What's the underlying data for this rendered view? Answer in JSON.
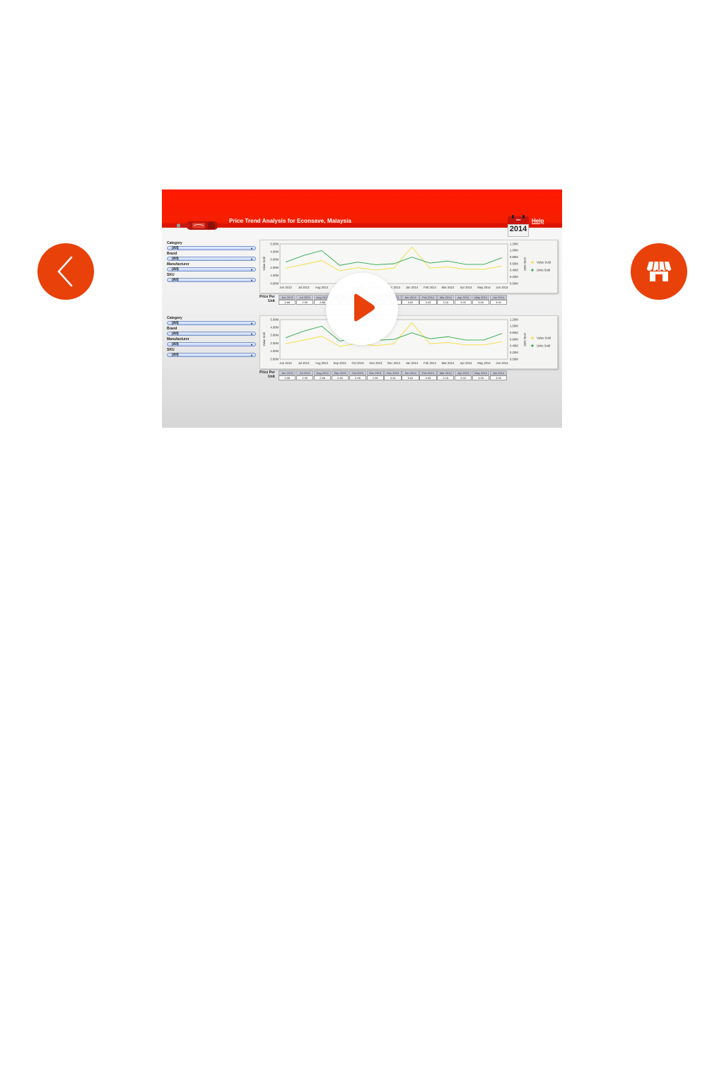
{
  "nav": {
    "back_icon": "chevron-left-icon",
    "store_icon": "storefront-icon",
    "accent": "#e8410a"
  },
  "dashboard": {
    "title": "Price Trend Analysis for Econsave, Malaysia",
    "help_label": "Help",
    "calendar": {
      "month": "Jun",
      "year": "2014"
    },
    "brand_color": "#ff1a00"
  },
  "panels": [
    {
      "filters": [
        {
          "label": "Category",
          "value": "(All)"
        },
        {
          "label": "Brand",
          "value": "(All)"
        },
        {
          "label": "Manufacturer",
          "value": "(All)"
        },
        {
          "label": "SKU",
          "value": "(All)"
        }
      ],
      "price_label_1": "Price Per",
      "price_label_2": "Unit",
      "price_values": [
        "3.68",
        "2.90",
        "2.88",
        "2.83",
        "2.98",
        "2.96",
        "3.34",
        "5.62",
        "3.03",
        "3.15",
        "3.02",
        "3.05",
        "3.00"
      ]
    },
    {
      "filters": [
        {
          "label": "Category",
          "value": "(All)"
        },
        {
          "label": "Brand",
          "value": "(All)"
        },
        {
          "label": "Manufacturer",
          "value": "(All)"
        },
        {
          "label": "SKU",
          "value": "(All)"
        }
      ],
      "price_label_1": "Price Per",
      "price_label_2": "Unit",
      "price_values": [
        "3.68",
        "2.90",
        "2.88",
        "2.83",
        "2.98",
        "2.96",
        "3.34",
        "5.62",
        "3.03",
        "3.15",
        "3.02",
        "3.05",
        "3.00"
      ]
    }
  ],
  "chart_data": [
    {
      "type": "line",
      "categories": [
        "Jun 2013",
        "Jul 2013",
        "Aug 2013",
        "Sep 2013",
        "Oct 2013",
        "Nov 2013",
        "Dec 2013",
        "Jan 2014",
        "Feb 2014",
        "Mar 2014",
        "Apr 2014",
        "May 2014",
        "Jun 2014"
      ],
      "ylabel": "Value Sold",
      "y2label": "Units Sold",
      "ylim": [
        0,
        5000000
      ],
      "y2lim": [
        0,
        1200000
      ],
      "yticks": [
        "0.00M",
        "1.00M",
        "2.00M",
        "3.00M",
        "4.00M",
        "5.00M"
      ],
      "y2ticks": [
        "0.00M",
        "0.20M",
        "0.40M",
        "0.60M",
        "0.80M",
        "1.00M",
        "1.20M"
      ],
      "legend_position": "right",
      "grid": false,
      "series": [
        {
          "name": "Value Sold",
          "color": "#f2dd3a",
          "axis": "left",
          "values": [
            1950000,
            2400000,
            2900000,
            1600000,
            2000000,
            1700000,
            1950000,
            4600000,
            1950000,
            2100000,
            1800000,
            1800000,
            2200000
          ]
        },
        {
          "name": "Units Sold",
          "color": "#2aa84a",
          "axis": "right",
          "values": [
            650000,
            850000,
            1000000,
            550000,
            650000,
            570000,
            600000,
            800000,
            620000,
            680000,
            580000,
            580000,
            780000
          ]
        }
      ]
    },
    {
      "type": "line",
      "categories": [
        "Jun 2013",
        "Jul 2013",
        "Aug 2013",
        "Sep 2013",
        "Oct 2013",
        "Nov 2013",
        "Dec 2013",
        "Jan 2014",
        "Feb 2014",
        "Mar 2014",
        "Apr 2014",
        "May 2014",
        "Jun 2014"
      ],
      "ylabel": "Value Sold",
      "y2label": "Units Sold",
      "ylim": [
        0,
        5000000
      ],
      "y2lim": [
        0,
        1200000
      ],
      "yticks": [
        "0.00M",
        "1.00M",
        "2.00M",
        "3.00M",
        "4.00M",
        "5.00M"
      ],
      "y2ticks": [
        "0.00M",
        "0.20M",
        "0.40M",
        "0.60M",
        "0.80M",
        "1.00M",
        "1.20M"
      ],
      "legend_position": "right",
      "grid": false,
      "series": [
        {
          "name": "Value Sold",
          "color": "#f2dd3a",
          "axis": "left",
          "values": [
            1950000,
            2400000,
            2900000,
            1600000,
            2000000,
            1700000,
            1950000,
            4600000,
            1950000,
            2100000,
            1800000,
            1800000,
            2200000
          ]
        },
        {
          "name": "Units Sold",
          "color": "#2aa84a",
          "axis": "right",
          "values": [
            650000,
            850000,
            1000000,
            550000,
            650000,
            570000,
            600000,
            800000,
            620000,
            680000,
            580000,
            580000,
            780000
          ]
        }
      ]
    }
  ],
  "video": {
    "play_icon": "play-icon",
    "play_color": "#e8410a"
  }
}
